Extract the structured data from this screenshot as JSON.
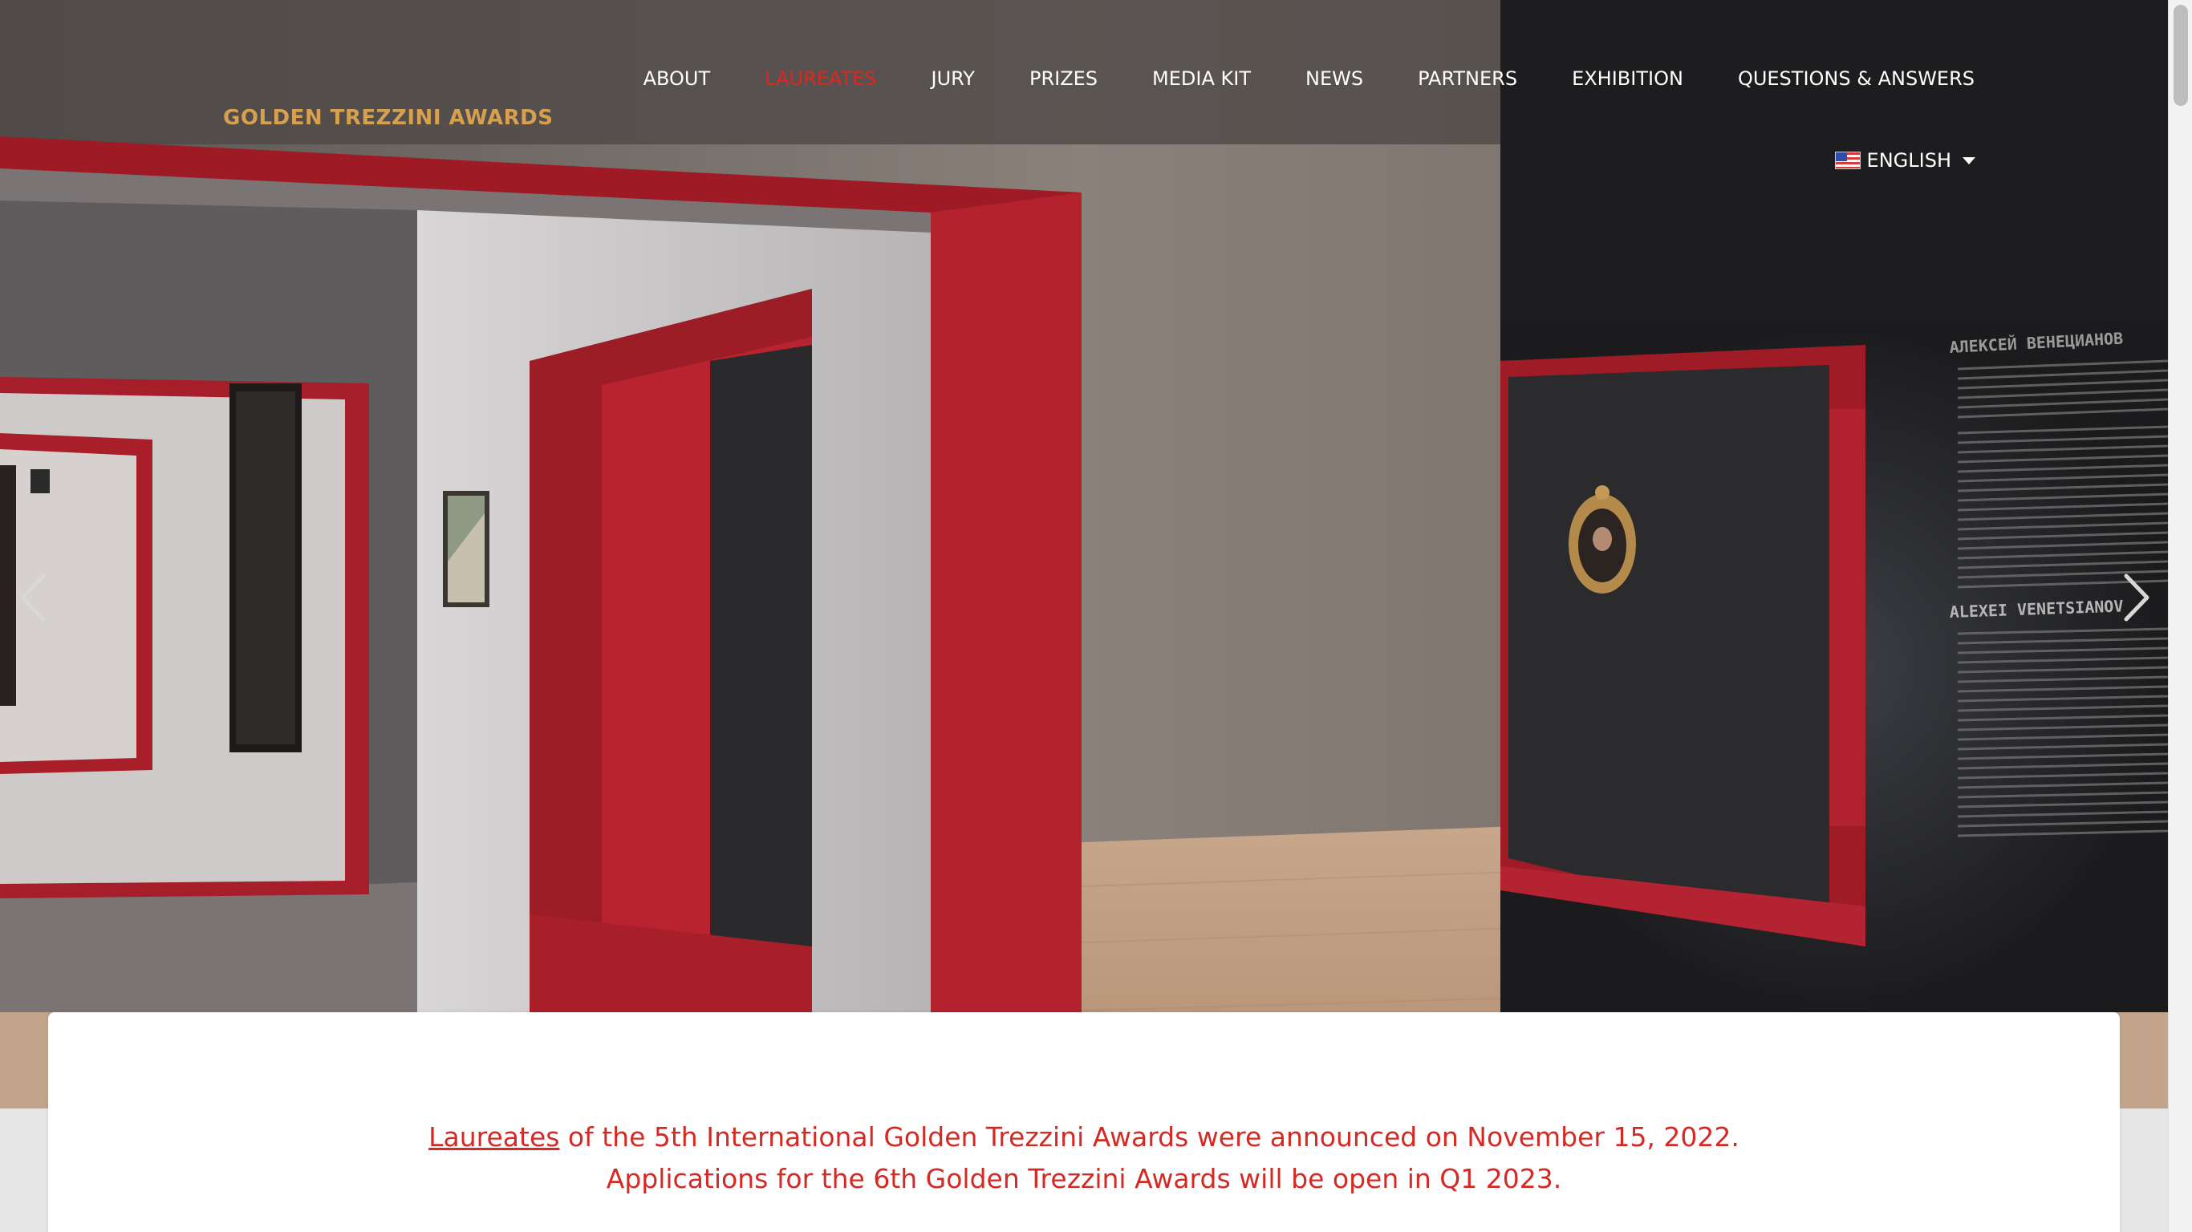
{
  "header": {
    "logo": "GOLDEN TREZZINI AWARDS",
    "nav": [
      {
        "label": "ABOUT",
        "active": false
      },
      {
        "label": "LAUREATES",
        "active": true
      },
      {
        "label": "JURY",
        "active": false
      },
      {
        "label": "PRIZES",
        "active": false
      },
      {
        "label": "MEDIA KIT",
        "active": false
      },
      {
        "label": "NEWS",
        "active": false
      },
      {
        "label": "PARTNERS",
        "active": false
      },
      {
        "label": "EXHIBITION",
        "active": false
      },
      {
        "label": "QUESTIONS & ANSWERS",
        "active": false
      }
    ],
    "language": {
      "label": "ENGLISH",
      "flag_icon": "us-flag-icon"
    }
  },
  "hero": {
    "exhibit_heading_ru": "АЛЕКСЕЙ ВЕНЕЦИАНОВ",
    "exhibit_heading_en": "ALEXEI VENETSIANOV",
    "prev_icon": "chevron-left-icon",
    "next_icon": "chevron-right-icon"
  },
  "announcement": {
    "link_text": "Laureates",
    "line1_rest": " of the 5th International Golden Trezzini Awards were announced on November 15, 2022.",
    "line2": "Applications for the 6th Golden Trezzini Awards will be open in Q1 2023."
  },
  "colors": {
    "accent_red": "#e0261f",
    "logo_gold": "#d6a04e",
    "announcement_red": "#d52a24"
  }
}
